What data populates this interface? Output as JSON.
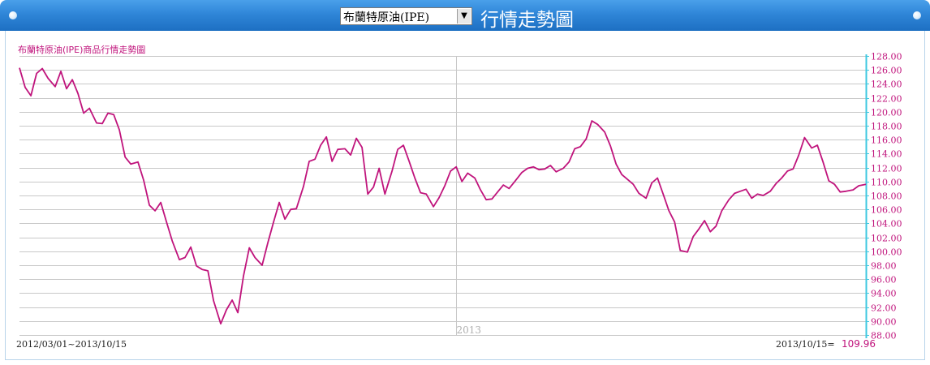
{
  "header": {
    "selector_value": "布蘭特原油(IPE)",
    "title": "行情走勢圖"
  },
  "chart_info": {
    "range": "2012/03/01~2013/10/15",
    "last_date_label": "2013/10/15=",
    "last_value": "109.96"
  },
  "colors": {
    "header": "#2f86d8",
    "line": "#c0147c",
    "axis": "#3ec8e0",
    "grid": "#c8c8c8"
  },
  "chart_data": {
    "type": "line",
    "title": "布蘭特原油(IPE)商品行情走勢圖",
    "ylim": [
      88,
      128
    ],
    "yticks": [
      "88.00",
      "90.00",
      "92.00",
      "94.00",
      "96.00",
      "98.00",
      "100.00",
      "102.00",
      "104.00",
      "106.00",
      "108.00",
      "110.00",
      "112.00",
      "114.00",
      "116.00",
      "118.00",
      "120.00",
      "122.00",
      "124.00",
      "126.00",
      "128.00"
    ],
    "year_marker": {
      "label": "2013",
      "date": "2013-01-01"
    },
    "x": [
      "2012-03-01",
      "2012-03-05",
      "2012-03-09",
      "2012-03-13",
      "2012-03-17",
      "2012-03-21",
      "2012-03-26",
      "2012-03-30",
      "2012-04-03",
      "2012-04-07",
      "2012-04-11",
      "2012-04-15",
      "2012-04-19",
      "2012-04-24",
      "2012-04-28",
      "2012-05-02",
      "2012-05-06",
      "2012-05-10",
      "2012-05-14",
      "2012-05-18",
      "2012-05-23",
      "2012-05-27",
      "2012-05-31",
      "2012-06-04",
      "2012-06-08",
      "2012-06-12",
      "2012-06-16",
      "2012-06-21",
      "2012-06-25",
      "2012-06-29",
      "2012-07-03",
      "2012-07-07",
      "2012-07-11",
      "2012-07-15",
      "2012-07-20",
      "2012-07-24",
      "2012-07-28",
      "2012-08-01",
      "2012-08-05",
      "2012-08-09",
      "2012-08-13",
      "2012-08-18",
      "2012-08-22",
      "2012-08-26",
      "2012-08-30",
      "2012-09-03",
      "2012-09-07",
      "2012-09-11",
      "2012-09-16",
      "2012-09-20",
      "2012-09-24",
      "2012-09-28",
      "2012-10-02",
      "2012-10-06",
      "2012-10-10",
      "2012-10-15",
      "2012-10-19",
      "2012-10-23",
      "2012-10-27",
      "2012-10-31",
      "2012-11-04",
      "2012-11-08",
      "2012-11-12",
      "2012-11-17",
      "2012-11-21",
      "2012-11-25",
      "2012-11-29",
      "2012-12-03",
      "2012-12-07",
      "2012-12-11",
      "2012-12-16",
      "2012-12-20",
      "2012-12-24",
      "2012-12-28",
      "2013-01-01",
      "2013-01-05",
      "2013-01-09",
      "2013-01-14",
      "2013-01-18",
      "2013-01-22",
      "2013-01-26",
      "2013-01-30",
      "2013-02-03",
      "2013-02-07",
      "2013-02-11",
      "2013-02-16",
      "2013-02-20",
      "2013-02-24",
      "2013-02-28",
      "2013-03-04",
      "2013-03-08",
      "2013-03-12",
      "2013-03-17",
      "2013-03-21",
      "2013-03-25",
      "2013-03-29",
      "2013-04-02",
      "2013-04-06",
      "2013-04-10",
      "2013-04-15",
      "2013-04-19",
      "2013-04-23",
      "2013-04-27",
      "2013-05-01",
      "2013-05-05",
      "2013-05-09",
      "2013-05-14",
      "2013-05-18",
      "2013-05-22",
      "2013-05-26",
      "2013-05-30",
      "2013-06-03",
      "2013-06-07",
      "2013-06-12",
      "2013-06-16",
      "2013-06-20",
      "2013-06-24",
      "2013-06-28",
      "2013-07-02",
      "2013-07-06",
      "2013-07-11",
      "2013-07-15",
      "2013-07-19",
      "2013-07-23",
      "2013-07-27",
      "2013-07-31",
      "2013-08-04",
      "2013-08-09",
      "2013-08-13",
      "2013-08-17",
      "2013-08-21",
      "2013-08-25",
      "2013-08-29",
      "2013-09-02",
      "2013-09-07",
      "2013-09-11",
      "2013-09-15",
      "2013-09-19",
      "2013-09-23",
      "2013-09-27",
      "2013-10-01",
      "2013-10-06",
      "2013-10-10",
      "2013-10-15"
    ],
    "values": [
      126.3,
      123.5,
      122.3,
      125.5,
      126.2,
      124.8,
      123.6,
      125.8,
      123.3,
      124.6,
      122.6,
      119.8,
      120.5,
      118.4,
      118.3,
      119.8,
      119.6,
      117.4,
      113.5,
      112.5,
      112.8,
      110.2,
      106.6,
      105.8,
      107.0,
      104.2,
      101.5,
      98.8,
      99.1,
      100.6,
      97.9,
      97.4,
      97.2,
      92.9,
      89.6,
      91.6,
      93.0,
      91.2,
      96.5,
      100.5,
      99.1,
      98.0,
      101.2,
      104.2,
      107.0,
      104.6,
      106.0,
      106.1,
      109.3,
      112.9,
      113.2,
      115.2,
      116.4,
      112.9,
      114.6,
      114.7,
      113.8,
      116.2,
      114.9,
      108.2,
      109.2,
      111.9,
      108.2,
      111.5,
      114.6,
      115.2,
      112.9,
      110.5,
      108.4,
      108.2,
      106.4,
      107.7,
      109.4,
      111.5,
      112.1,
      110.0,
      111.2,
      110.5,
      108.8,
      107.4,
      107.5,
      108.5,
      109.5,
      109.0,
      110.0,
      111.3,
      111.9,
      112.1,
      111.7,
      111.8,
      112.3,
      111.4,
      111.9,
      112.8,
      114.7,
      115.0,
      116.1,
      118.7,
      118.2,
      117.1,
      115.1,
      112.5,
      111.0,
      110.3,
      109.6,
      108.3,
      107.6,
      109.8,
      110.5,
      108.2,
      105.8,
      104.2,
      100.1,
      99.9,
      102.1,
      103.2,
      104.4,
      102.8,
      103.6,
      105.8,
      107.4,
      108.3,
      108.6,
      108.9,
      107.6,
      108.2,
      108.0,
      108.6,
      109.7,
      110.5,
      111.5,
      111.8,
      113.8,
      116.3,
      114.8,
      115.2,
      112.8,
      110.1,
      109.6,
      108.5,
      108.6,
      108.8,
      109.4,
      109.6
    ]
  }
}
